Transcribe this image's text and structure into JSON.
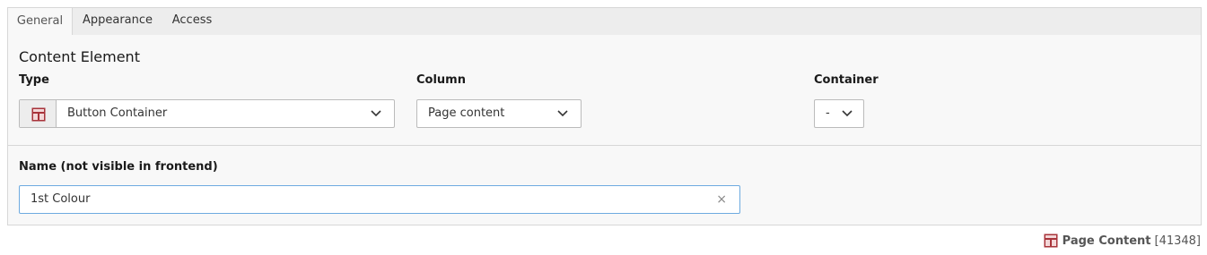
{
  "tabs": [
    {
      "label": "General",
      "active": true
    },
    {
      "label": "Appearance",
      "active": false
    },
    {
      "label": "Access",
      "active": false
    }
  ],
  "section": {
    "title": "Content Element"
  },
  "fields": {
    "type": {
      "label": "Type",
      "value": "Button Container",
      "icon": "content-element-icon"
    },
    "column": {
      "label": "Column",
      "value": "Page content"
    },
    "container": {
      "label": "Container",
      "value": "-"
    },
    "name": {
      "label": "Name (not visible in frontend)",
      "value": "1st Colour",
      "clear": "×"
    }
  },
  "footer": {
    "title": "Page Content",
    "id": "[41348]",
    "icon": "page-content-icon"
  },
  "colors": {
    "icon_red": "#a8333a",
    "input_focus_border": "#6daae0"
  }
}
